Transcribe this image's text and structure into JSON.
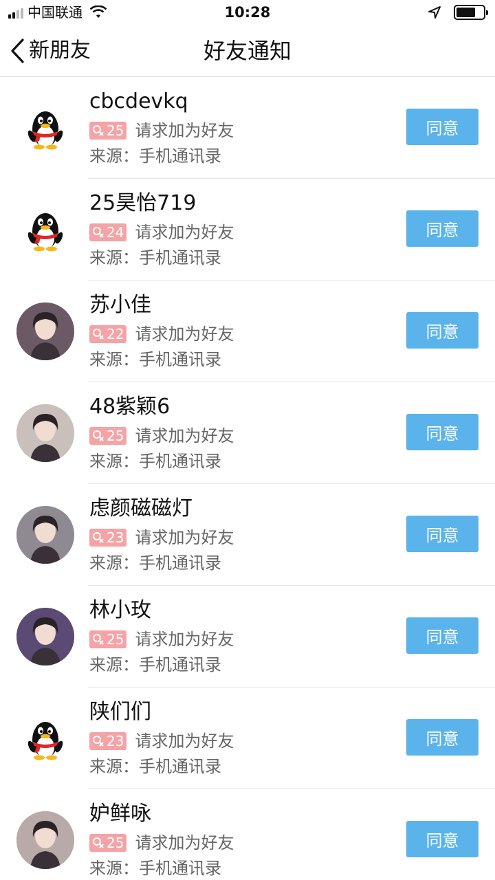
{
  "status": {
    "carrier": "中国联通",
    "time": "10:28"
  },
  "nav": {
    "back_label": "新朋友",
    "title": "好友通知"
  },
  "requests": [
    {
      "name": "cbcdevkq",
      "age": "25",
      "request_text": "请求加为好友",
      "source": "来源：手机通讯录",
      "button": "同意",
      "avatar": "qq-penguin-icon"
    },
    {
      "name": "25昊怡719",
      "age": "24",
      "request_text": "请求加为好友",
      "source": "来源：手机通讯录",
      "button": "同意",
      "avatar": "qq-penguin-icon"
    },
    {
      "name": "苏小佳",
      "age": "22",
      "request_text": "请求加为好友",
      "source": "来源：手机通讯录",
      "button": "同意",
      "avatar": "photo"
    },
    {
      "name": "48紫颖6",
      "age": "25",
      "request_text": "请求加为好友",
      "source": "来源：手机通讯录",
      "button": "同意",
      "avatar": "photo"
    },
    {
      "name": "虑颜磁磁灯",
      "age": "23",
      "request_text": "请求加为好友",
      "source": "来源：手机通讯录",
      "button": "同意",
      "avatar": "photo"
    },
    {
      "name": "林小玫",
      "age": "25",
      "request_text": "请求加为好友",
      "source": "来源：手机通讯录",
      "button": "同意",
      "avatar": "photo"
    },
    {
      "name": "陕们们",
      "age": "23",
      "request_text": "请求加为好友",
      "source": "来源：手机通讯录",
      "button": "同意",
      "avatar": "qq-penguin-icon"
    },
    {
      "name": "妒鲜咏",
      "age": "25",
      "request_text": "请求加为好友",
      "source": "来源：手机通讯录",
      "button": "同意",
      "avatar": "photo"
    }
  ],
  "colors": {
    "accent": "#5ab3ea",
    "badge": "#f4a3a6"
  }
}
